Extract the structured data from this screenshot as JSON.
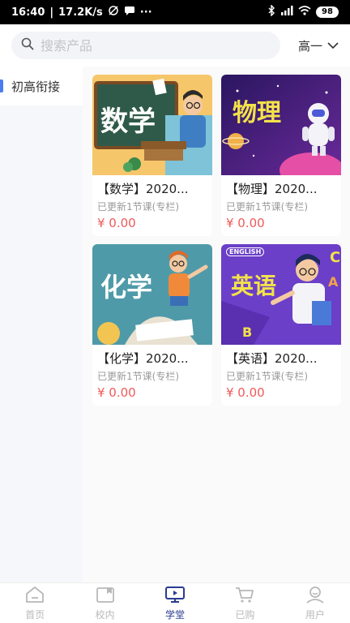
{
  "status_bar": {
    "time": "16:40",
    "speed": "17.2K/s",
    "battery": "98"
  },
  "search": {
    "placeholder": "搜索产品"
  },
  "grade_selector": {
    "value": "高一"
  },
  "sidebar": {
    "items": [
      {
        "label": "初高衔接",
        "active": true
      }
    ]
  },
  "courses": [
    {
      "thumb_text": "数学",
      "title": "【数学】2020...",
      "subtitle": "已更新1节课(专栏)",
      "price": "¥ 0.00",
      "bg": "#2f5a4a"
    },
    {
      "thumb_text": "物理",
      "title": "【物理】2020...",
      "subtitle": "已更新1节课(专栏)",
      "price": "¥ 0.00",
      "bg": "#3b1d6e"
    },
    {
      "thumb_text": "化学",
      "title": "【化学】2020...",
      "subtitle": "已更新1节课(专栏)",
      "price": "¥ 0.00",
      "bg": "#4f9aa8"
    },
    {
      "thumb_text": "英语",
      "title": "【英语】2020...",
      "subtitle": "已更新1节课(专栏)",
      "price": "¥ 0.00",
      "bg": "#6b3fc8",
      "badge": "ENGLISH"
    }
  ],
  "tabbar": {
    "items": [
      {
        "label": "首页",
        "icon": "home-icon"
      },
      {
        "label": "校内",
        "icon": "school-icon"
      },
      {
        "label": "学堂",
        "icon": "classroom-icon",
        "active": true
      },
      {
        "label": "已购",
        "icon": "cart-icon"
      },
      {
        "label": "用户",
        "icon": "user-icon"
      }
    ]
  },
  "colors": {
    "accent": "#4c7cf3",
    "price": "#f05a5a",
    "active_tab": "#2a3b8f"
  }
}
